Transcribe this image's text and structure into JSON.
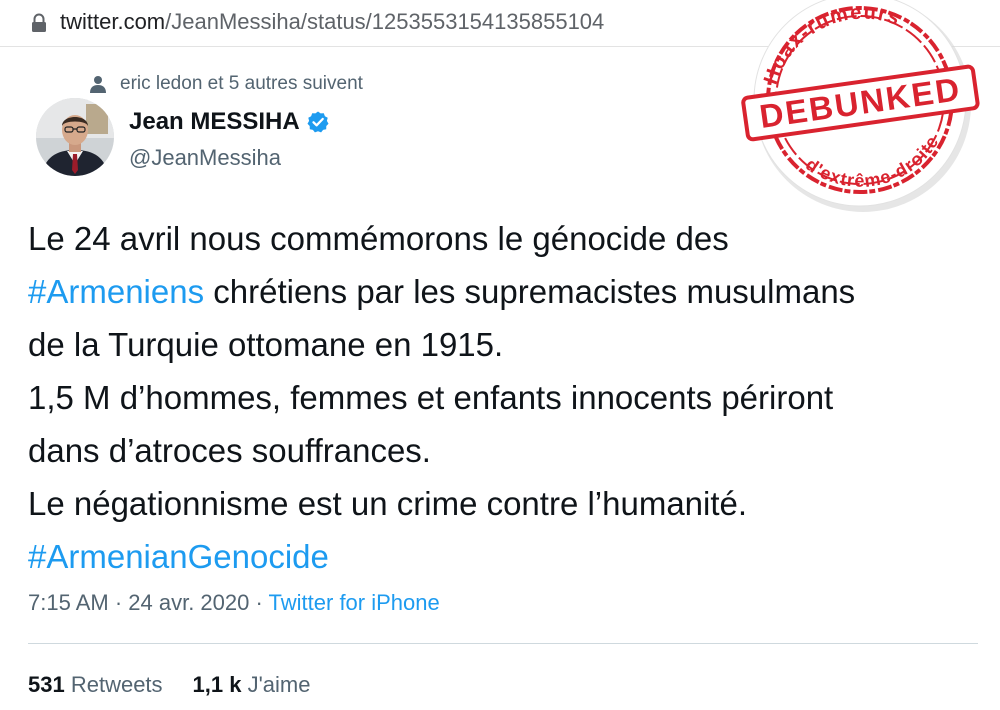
{
  "browser": {
    "url_host": "twitter.com",
    "url_path": "/JeanMessiha/status/1253553154135855104"
  },
  "tweet": {
    "social_context": "eric ledon et 5 autres suivent",
    "display_name": "Jean MESSIHA",
    "handle": "@JeanMessiha",
    "lines": [
      {
        "hashtag": "",
        "text": "Le 24 avril nous commémorons  le génocide des"
      },
      {
        "hashtag": "#Armeniens",
        "text": " chrétiens par les supremacistes musulmans"
      },
      {
        "hashtag": "",
        "text": "de la Turquie ottomane en 1915."
      },
      {
        "hashtag": "",
        "text": "1,5 M d’hommes, femmes et enfants innocents périront"
      },
      {
        "hashtag": "",
        "text": "dans d’atroces souffrances."
      },
      {
        "hashtag": "",
        "text": "Le négationnisme est un crime contre l’humanité."
      },
      {
        "hashtag": "#ArmenianGenocide",
        "text": ""
      }
    ],
    "time": "7:15 AM",
    "date": "24 avr. 2020",
    "separator": " · ",
    "source": "Twitter for iPhone",
    "retweets_count": "531",
    "retweets_label": " Retweets",
    "likes_count": "1,1 k",
    "likes_label": " J'aime"
  },
  "stamp": {
    "top_text": "Hoax-rumeurs",
    "center_text": "DEBUNKED",
    "bottom_text": "d'extrême-droite",
    "color": "#d9232f"
  },
  "colors": {
    "link": "#1d9bf0",
    "secondary_text": "#536471",
    "primary_text": "#0f1419",
    "verified": "#1d9bf0"
  },
  "icons": {
    "address_bar": "lock-icon",
    "social_context": "person-icon",
    "badge": "verified-badge-icon"
  }
}
